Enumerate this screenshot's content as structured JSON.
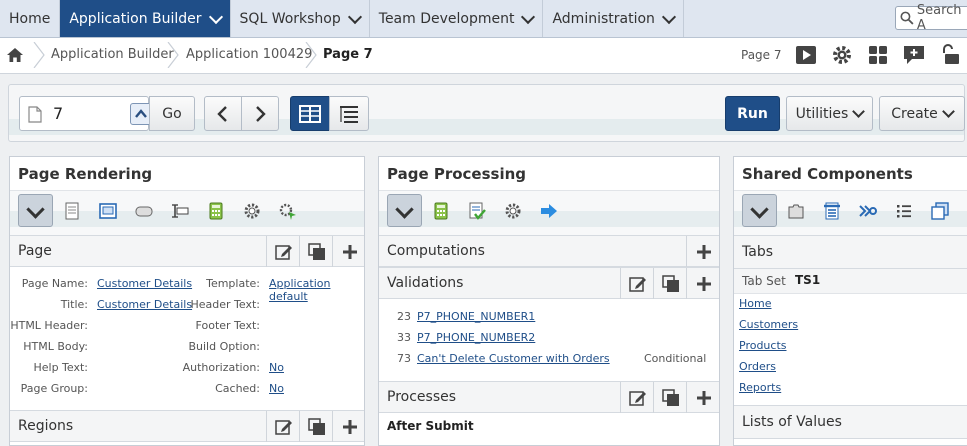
{
  "topnav": {
    "tabs": [
      "Home",
      "Application Builder",
      "SQL Workshop",
      "Team Development",
      "Administration"
    ],
    "search_placeholder": "Search A"
  },
  "breadcrumb": {
    "items": [
      "Application Builder",
      "Application 100429"
    ],
    "current": "Page 7",
    "page_label": "Page 7"
  },
  "toolbar": {
    "page_number": "7",
    "go_label": "Go",
    "run_label": "Run",
    "utilities_label": "Utilities",
    "create_label": "Create"
  },
  "rendering": {
    "title": "Page Rendering",
    "page_section": "Page",
    "left_fields": [
      {
        "label": "Page Name:",
        "value": "Customer Details"
      },
      {
        "label": "Title:",
        "value": "Customer Details"
      },
      {
        "label": "HTML Header:",
        "value": ""
      },
      {
        "label": "HTML Body:",
        "value": ""
      },
      {
        "label": "Help Text:",
        "value": ""
      },
      {
        "label": "Page Group:",
        "value": ""
      }
    ],
    "right_fields": [
      {
        "label": "Template:",
        "value": "Application default"
      },
      {
        "label": "Header Text:",
        "value": ""
      },
      {
        "label": "Footer Text:",
        "value": ""
      },
      {
        "label": "Build Option:",
        "value": ""
      },
      {
        "label": "Authorization:",
        "value": "No"
      },
      {
        "label": "Cached:",
        "value": "No"
      }
    ],
    "regions_section": "Regions"
  },
  "processing": {
    "title": "Page Processing",
    "computations": "Computations",
    "validations": "Validations",
    "validation_items": [
      {
        "seq": "23",
        "name": "P7_PHONE_NUMBER1",
        "cond": ""
      },
      {
        "seq": "33",
        "name": "P7_PHONE_NUMBER2",
        "cond": ""
      },
      {
        "seq": "73",
        "name": "Can't Delete Customer with Orders",
        "cond": "Conditional"
      }
    ],
    "processes": "Processes",
    "after_submit": "After Submit"
  },
  "shared": {
    "title": "Shared Components",
    "tabs_section": "Tabs",
    "tab_set_label": "Tab Set",
    "tab_set_value": "TS1",
    "tabs": [
      "Home",
      "Customers",
      "Products",
      "Orders",
      "Reports"
    ],
    "lov_section": "Lists of Values"
  },
  "colors": {
    "nav_active": "#1f4e88",
    "link": "#1f4e88",
    "run_button": "#1f4e88"
  }
}
